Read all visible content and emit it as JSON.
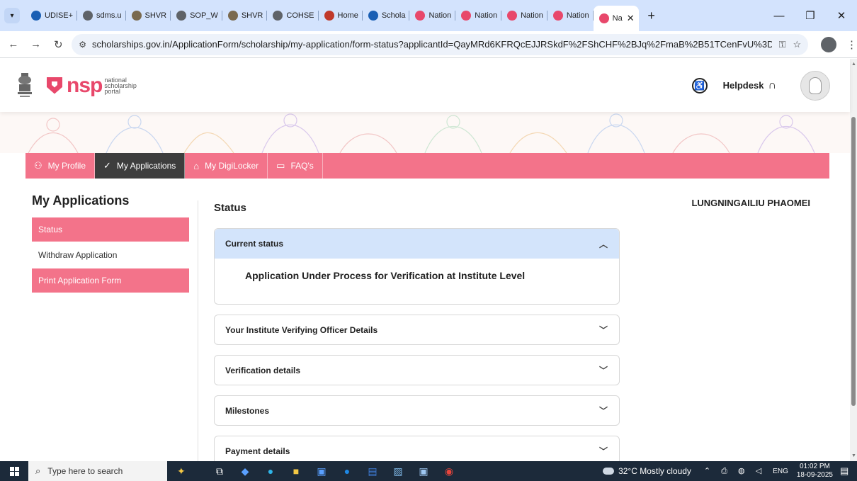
{
  "browser": {
    "tabs": [
      {
        "label": "UDISE+",
        "icon": "udise-favicon",
        "color": "#1a5fb4"
      },
      {
        "label": "sdms.u",
        "icon": "globe-favicon",
        "color": "#5f6368"
      },
      {
        "label": "SHVR",
        "icon": "emblem-favicon",
        "color": "#7a6a4f"
      },
      {
        "label": "SOP_W",
        "icon": "globe-favicon",
        "color": "#5f6368"
      },
      {
        "label": "SHVR",
        "icon": "emblem-favicon",
        "color": "#7a6a4f"
      },
      {
        "label": "COHSE",
        "icon": "cohse-favicon",
        "color": "#5f6368"
      },
      {
        "label": "Home",
        "icon": "home-favicon",
        "color": "#c0392b"
      },
      {
        "label": "Schola",
        "icon": "scholar-favicon",
        "color": "#1a5fb4"
      },
      {
        "label": "Nation",
        "icon": "nsp-favicon",
        "color": "#e8486b"
      },
      {
        "label": "Nation",
        "icon": "nsp-favicon",
        "color": "#e8486b"
      },
      {
        "label": "Nation",
        "icon": "nsp-favicon",
        "color": "#e8486b"
      },
      {
        "label": "Nation",
        "icon": "nsp-favicon",
        "color": "#e8486b"
      }
    ],
    "active_tab": {
      "label": "Na",
      "icon": "nsp-favicon",
      "color": "#e8486b"
    },
    "url": "scholarships.gov.in/ApplicationForm/scholarship/my-application/form-status?applicantId=QayMRd6KFRQcEJJRSkdF%2FShCHF%2BJq%2FmaB%2B51TCenFvU%3D&app..."
  },
  "header": {
    "brand": "nsp",
    "brand_sub1": "national",
    "brand_sub2": "scholarship",
    "brand_sub3": "portal",
    "helpdesk": "Helpdesk"
  },
  "nav": {
    "tabs": [
      {
        "label": "My Profile",
        "icon": "user-icon"
      },
      {
        "label": "My Applications",
        "icon": "check-circle-icon"
      },
      {
        "label": "My DigiLocker",
        "icon": "lock-icon"
      },
      {
        "label": "FAQ's",
        "icon": "chat-icon"
      }
    ]
  },
  "sidebar": {
    "title": "My Applications",
    "items": [
      "Status",
      "Withdraw Application",
      "Print Application Form"
    ]
  },
  "main": {
    "title": "Status",
    "current_status_label": "Current status",
    "current_status_text": "Application Under Process for Verification at Institute Level",
    "sections": [
      "Your Institute Verifying Officer Details",
      "Verification details",
      "Milestones",
      "Payment details"
    ]
  },
  "user": {
    "name": "LUNGNINGAILIU PHAOMEI"
  },
  "taskbar": {
    "search_placeholder": "Type here to search",
    "weather": "32°C  Mostly cloudy",
    "weather_badge": "1",
    "lang": "ENG",
    "time": "01:02 PM",
    "date": "18-09-2025",
    "notif_count": "7"
  },
  "colors": {
    "accent_pink": "#f3738a",
    "active_nav": "#3d3d3d",
    "open_header": "#d3e4fb"
  }
}
